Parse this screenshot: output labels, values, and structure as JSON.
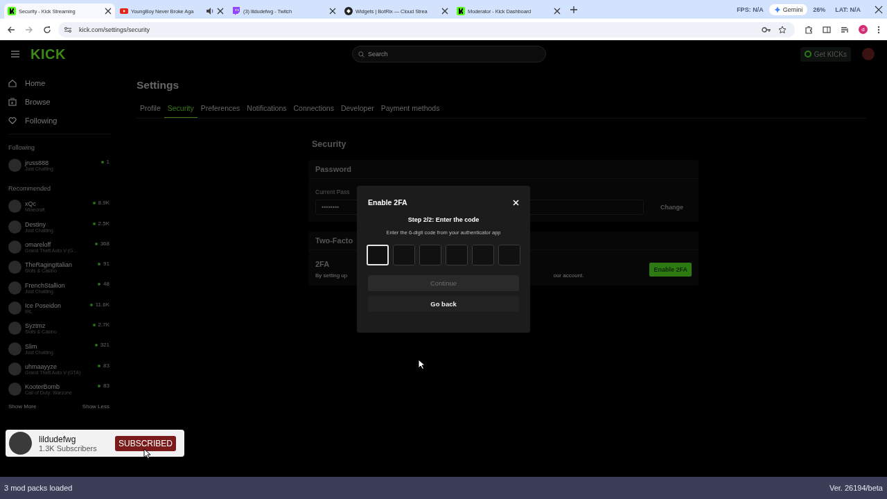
{
  "browser": {
    "tabs": [
      {
        "title": "Security - Kick Streaming",
        "kind": "kick",
        "selected": true,
        "audio": false
      },
      {
        "title": "YoungBoy Never Broke Aga",
        "kind": "youtube",
        "selected": false,
        "audio": true
      },
      {
        "title": "(3) lildudefwg - Twitch",
        "kind": "twitch",
        "selected": false,
        "audio": false
      },
      {
        "title": "Widgets | BotRix — Cloud Strea",
        "kind": "github",
        "selected": false,
        "audio": false
      },
      {
        "title": "Moderator - Kick Dashboard",
        "kind": "kick",
        "selected": false,
        "audio": false
      }
    ],
    "overlay_stats": [
      "FPS: N/A",
      "26%",
      "LAT: N/A"
    ],
    "gemini": "Gemini",
    "url": "kick.com/settings/security",
    "profile_initial": "d"
  },
  "site": {
    "logo": "KICK",
    "search_placeholder": "Search",
    "get_kicks": "Get KICKs",
    "nav": [
      {
        "label": "Home",
        "kind": "home"
      },
      {
        "label": "Browse",
        "kind": "browse"
      },
      {
        "label": "Following",
        "kind": "heart"
      }
    ],
    "following_heading": "Following",
    "following": [
      {
        "name": "jruss888",
        "category": "Just Chatting",
        "viewers": "1"
      }
    ],
    "recommended_heading": "Recommended",
    "recommended": [
      {
        "name": "xQc",
        "category": "Minecraft",
        "viewers": "8.9K"
      },
      {
        "name": "Destiny",
        "category": "Just Chatting",
        "viewers": "2.5K"
      },
      {
        "name": "omareloff",
        "category": "Grand Theft Auto V (G...",
        "viewers": "368"
      },
      {
        "name": "TheRagingItalian",
        "category": "Slots & Casino",
        "viewers": "91"
      },
      {
        "name": "FrenchStallion",
        "category": "Just Chatting",
        "viewers": "48"
      },
      {
        "name": "Ice Poseidon",
        "category": "IRL",
        "viewers": "11.6K"
      },
      {
        "name": "Syztmz",
        "category": "Slots & Casino",
        "viewers": "2.7K"
      },
      {
        "name": "Slim",
        "category": "Just Chatting",
        "viewers": "321"
      },
      {
        "name": "uhmaayyze",
        "category": "Grand Theft Auto V (GTA)",
        "viewers": "83"
      },
      {
        "name": "KooterBomb",
        "category": "Call of Duty: Warzone",
        "viewers": "83"
      }
    ],
    "show_more": "Show More",
    "show_less": "Show Less"
  },
  "settings": {
    "title": "Settings",
    "tabs": [
      {
        "label": "Profile",
        "selected": false
      },
      {
        "label": "Security",
        "selected": true
      },
      {
        "label": "Preferences",
        "selected": false
      },
      {
        "label": "Notifications",
        "selected": false
      },
      {
        "label": "Connections",
        "selected": false
      },
      {
        "label": "Developer",
        "selected": false
      },
      {
        "label": "Payment methods",
        "selected": false
      }
    ],
    "section_title": "Security",
    "password": {
      "title": "Password",
      "field_label": "Current Pass",
      "value": "••••••••",
      "button": "Change"
    },
    "two_factor": {
      "title": "Two-Facto",
      "label": "2FA",
      "description_start": "By setting up",
      "description_end": "our account.",
      "button": "Enable 2FA"
    }
  },
  "modal": {
    "title": "Enable 2FA",
    "step": "Step 2/2: Enter the code",
    "hint": "Enter the 6-digit code from your authenticator app",
    "code_boxes": [
      {
        "selected": true
      },
      {
        "selected": false
      },
      {
        "selected": false
      },
      {
        "selected": false
      },
      {
        "selected": false
      },
      {
        "selected": false
      }
    ],
    "continue": {
      "label": "Continue",
      "disabled": true
    },
    "go_back": "Go back"
  },
  "subscribe_toast": {
    "channel": "lildudefwg",
    "subscribers": "1.3K Subscribers",
    "button": "SUBSCRIBED"
  },
  "status_bar": {
    "left": "3 mod packs loaded",
    "right": "Ver. 26194/beta"
  }
}
